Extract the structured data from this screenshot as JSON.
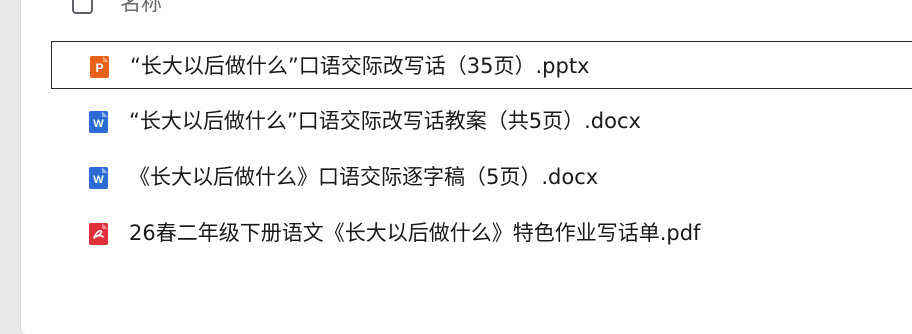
{
  "header": {
    "name_column_label": "名称"
  },
  "files": [
    {
      "name": "“长大以后做什么”口语交际改写话（35页）.pptx",
      "type": "pptx",
      "icon": "powerpoint-file-icon",
      "icon_letter": "P",
      "icon_color": "#e8621c",
      "selected": true
    },
    {
      "name": "“长大以后做什么”口语交际改写话教案（共5页）.docx",
      "type": "docx",
      "icon": "word-file-icon",
      "icon_letter": "W",
      "icon_color": "#2b6bd6",
      "selected": false
    },
    {
      "name": "《长大以后做什么》口语交际逐字稿（5页）.docx",
      "type": "docx",
      "icon": "word-file-icon",
      "icon_letter": "W",
      "icon_color": "#2b6bd6",
      "selected": false
    },
    {
      "name": "26春二年级下册语文《长大以后做什么》特色作业写话单.pdf",
      "type": "pdf",
      "icon": "pdf-file-icon",
      "icon_letter": "",
      "icon_color": "#e0303b",
      "selected": false
    }
  ]
}
